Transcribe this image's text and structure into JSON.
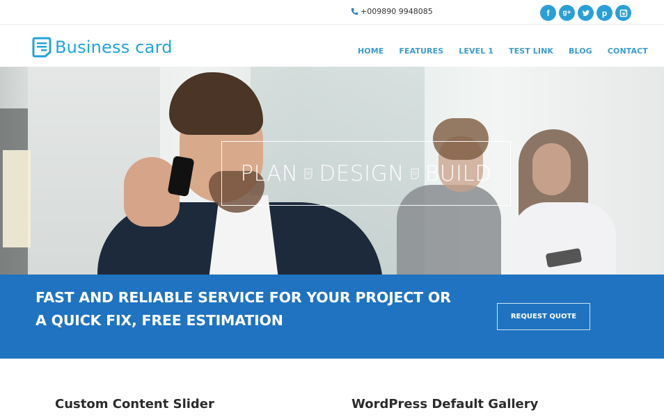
{
  "topbar": {
    "phone": "+009890 9948085",
    "phone_icon": "phone-icon",
    "socials": [
      {
        "name": "facebook",
        "glyph": "f"
      },
      {
        "name": "google-plus",
        "glyph": "g+"
      },
      {
        "name": "twitter",
        "glyph": ""
      },
      {
        "name": "pinterest",
        "glyph": "p"
      },
      {
        "name": "instagram",
        "glyph": ""
      }
    ],
    "social_color": "#2a9fd6"
  },
  "header": {
    "logo_text": "Business card",
    "brand_color": "#1fa3dc",
    "nav": [
      "HOME",
      "FEATURES",
      "LEVEL 1",
      "TEST LINK",
      "BLOG",
      "CONTACT"
    ]
  },
  "hero": {
    "tagline": [
      "PLAN",
      "DESIGN",
      "BUILD"
    ]
  },
  "cta": {
    "line1": "FAST AND RELIABLE SERVICE FOR YOUR PROJECT OR",
    "line2": "A QUICK FIX, FREE ESTIMATION",
    "button": "REQUEST QUOTE",
    "background": "#2073c0"
  },
  "sections": {
    "left_title": "Custom Content Slider",
    "right_title": "WordPress Default Gallery"
  }
}
